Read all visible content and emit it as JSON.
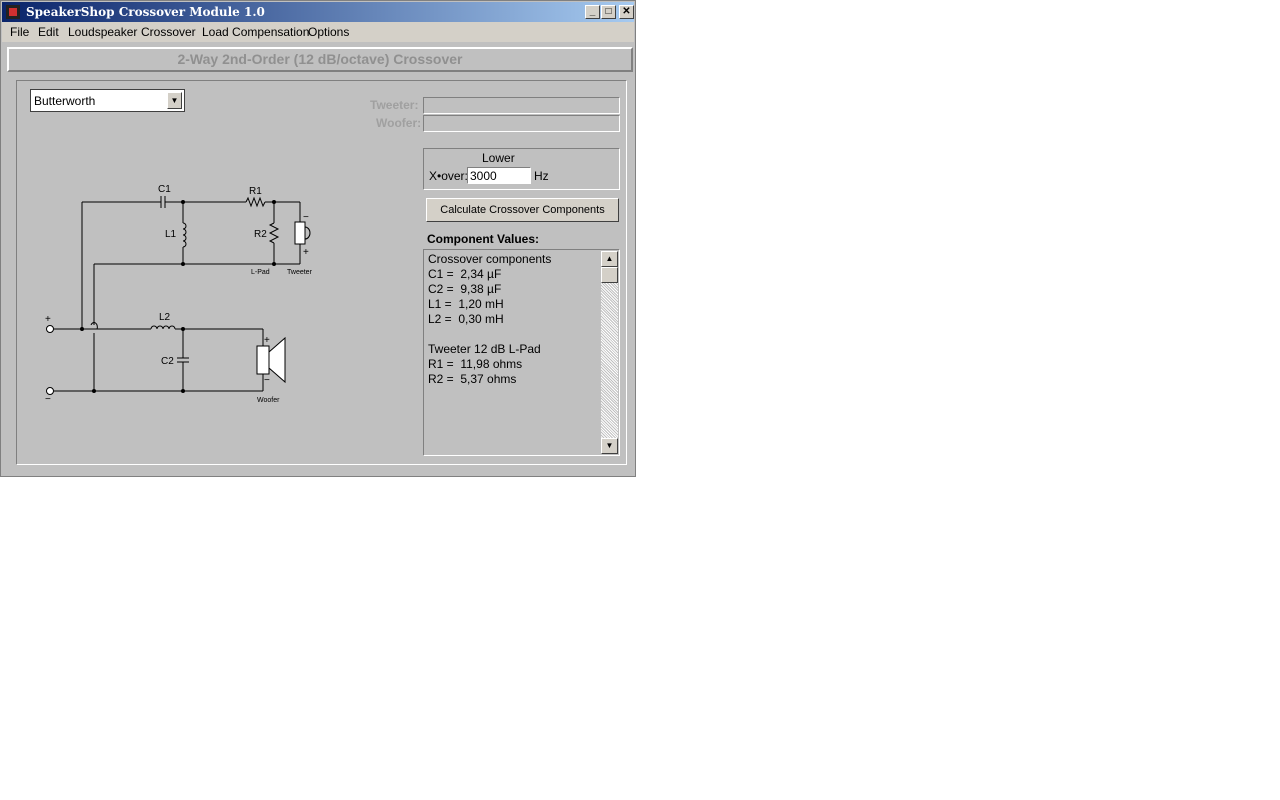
{
  "window": {
    "title": "SpeakerShop Crossover Module 1.0",
    "minimize_glyph": "_",
    "maximize_glyph": "□",
    "close_glyph": "✕"
  },
  "menu": {
    "items": [
      "File",
      "Edit",
      "Loudspeaker",
      "Crossover",
      "Load Compensation",
      "Options"
    ]
  },
  "header": {
    "title": "2-Way 2nd-Order (12 dB/octave) Crossover"
  },
  "alignment": {
    "selected": "Butterworth",
    "dropdown_glyph": "▼"
  },
  "drivers": {
    "tweeter_label": "Tweeter:",
    "woofer_label": "Woofer:",
    "tweeter_value": "",
    "woofer_value": ""
  },
  "xover": {
    "group_title": "Lower",
    "label": "X•over:",
    "value": "3000",
    "unit": "Hz"
  },
  "calculate_button": "Calculate Crossover Components",
  "components": {
    "heading": "Component Values:",
    "lines": [
      "Crossover components",
      "C1 =  2,34 µF",
      "C2 =  9,38 µF",
      "L1 =  1,20 mH",
      "L2 =  0,30 mH",
      "",
      "Tweeter 12 dB L-Pad",
      "R1 =  11,98 ohms",
      "R2 =  5,37 ohms"
    ],
    "scroll_up_glyph": "▲",
    "scroll_down_glyph": "▼"
  },
  "schematic": {
    "labels": {
      "c1": "C1",
      "r1": "R1",
      "l1": "L1",
      "r2": "R2",
      "l2": "L2",
      "c2": "C2",
      "lpad": "L-Pad",
      "tweeter": "Tweeter",
      "woofer": "Woofer",
      "plus": "+",
      "minus": "−"
    }
  }
}
